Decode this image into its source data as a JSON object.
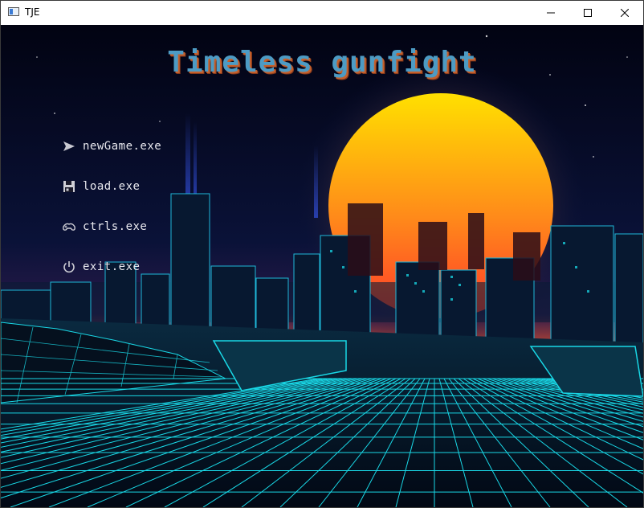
{
  "window": {
    "title": "TJE",
    "controls": {
      "minimize": "minimize-icon",
      "maximize": "maximize-icon",
      "close": "close-icon"
    }
  },
  "game": {
    "title": "Timeless gunfight",
    "title_color": "#4d9bc4",
    "title_shadow_color": "#c4602d"
  },
  "menu": {
    "items": [
      {
        "label": "newGame.exe",
        "icon": "play-arrow-icon"
      },
      {
        "label": "load.exe",
        "icon": "floppy-disk-icon"
      },
      {
        "label": "ctrls.exe",
        "icon": "gamepad-icon"
      },
      {
        "label": "exit.exe",
        "icon": "power-icon"
      }
    ]
  },
  "colors": {
    "sky_top": "#020312",
    "sky_mid": "#0a1238",
    "horizon_glow": "#ff5a2a",
    "sun_top": "#ffe000",
    "sun_bottom": "#ff3a2a",
    "grid_neon": "#19d8e6",
    "building_dark": "#071830"
  }
}
